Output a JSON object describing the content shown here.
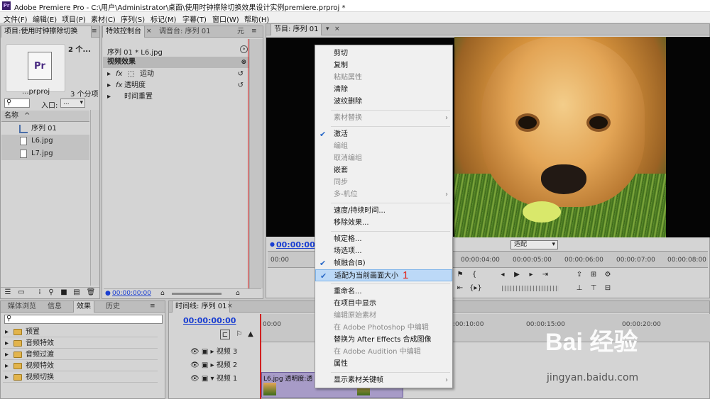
{
  "window": {
    "logo": "Pr",
    "title": "Adobe Premiere Pro - C:\\用户\\Administrator\\桌面\\使用时钟擦除切换效果设计实例premiere.prproj *"
  },
  "menu": [
    "文件(F)",
    "编辑(E)",
    "项目(P)",
    "素材(C)",
    "序列(S)",
    "标记(M)",
    "字幕(T)",
    "窗口(W)",
    "帮助(H)"
  ],
  "project": {
    "tab": "项目:使用时钟擦除切换",
    "item_count": "2 个...",
    "icon_text": "Pr",
    "filename": "...prproj",
    "subcount": "3 个分项",
    "entry_label": "入口:",
    "entry_value": "...",
    "column_name": "名称",
    "items": [
      "序列 01",
      "L6.jpg",
      "L7.jpg"
    ]
  },
  "effect_controls": {
    "tabs": [
      "特效控制台",
      "调音台: 序列 01",
      "元"
    ],
    "clip_label": "序列 01 * L6.jpg",
    "section": "视频效果",
    "rows": [
      "运动",
      "透明度",
      "时间重置"
    ],
    "timecode": "00:00:00:00"
  },
  "program": {
    "tab": "节目: 序列 01",
    "timecode": "00:00:00:0",
    "fit": "适配",
    "ruler": [
      "00:00",
      "00:00:04:00",
      "00:00:05:00",
      "00:00:06:00",
      "00:00:07:00",
      "00:00:08:00"
    ]
  },
  "effects": {
    "tabs": [
      "媒体浏览",
      "信息",
      "效果",
      "历史"
    ],
    "folders": [
      "预置",
      "音频特效",
      "音频过渡",
      "视频特效",
      "视频切换"
    ]
  },
  "timeline": {
    "tab": "时间线: 序列 01",
    "timecode": "00:00:00:00",
    "ruler": [
      "00:00",
      ":00:10:00",
      "00:00:15:00",
      "00:00:20:00"
    ],
    "tracks": [
      "视频 3",
      "视频 2",
      "视频 1"
    ],
    "clip": "L6.jpg  透明度:透"
  },
  "context_menu": {
    "items": [
      {
        "label": "剪切",
        "disabled": false,
        "checked": false,
        "submenu": false
      },
      {
        "label": "复制",
        "disabled": false,
        "checked": false,
        "submenu": false
      },
      {
        "label": "粘贴属性",
        "disabled": true,
        "checked": false,
        "submenu": false
      },
      {
        "label": "清除",
        "disabled": false,
        "checked": false,
        "submenu": false
      },
      {
        "label": "波纹删除",
        "disabled": false,
        "checked": false,
        "submenu": false
      },
      {
        "label": "素材替换",
        "disabled": true,
        "checked": false,
        "submenu": true
      },
      {
        "label": "激活",
        "disabled": false,
        "checked": true,
        "submenu": false
      },
      {
        "label": "编组",
        "disabled": true,
        "checked": false,
        "submenu": false
      },
      {
        "label": "取消编组",
        "disabled": true,
        "checked": false,
        "submenu": false
      },
      {
        "label": "嵌套",
        "disabled": false,
        "checked": false,
        "submenu": false
      },
      {
        "label": "同步",
        "disabled": true,
        "checked": false,
        "submenu": false
      },
      {
        "label": "多-机位",
        "disabled": true,
        "checked": false,
        "submenu": true
      },
      {
        "label": "速度/持续时间...",
        "disabled": false,
        "checked": false,
        "submenu": false
      },
      {
        "label": "移除效果...",
        "disabled": false,
        "checked": false,
        "submenu": false
      },
      {
        "label": "帧定格...",
        "disabled": false,
        "checked": false,
        "submenu": false
      },
      {
        "label": "场选项...",
        "disabled": false,
        "checked": false,
        "submenu": false
      },
      {
        "label": "帧融合(B)",
        "disabled": false,
        "checked": true,
        "submenu": false
      },
      {
        "label": "适配为当前画面大小",
        "disabled": false,
        "checked": true,
        "submenu": false,
        "highlighted": true
      },
      {
        "label": "重命名...",
        "disabled": false,
        "checked": false,
        "submenu": false
      },
      {
        "label": "在项目中显示",
        "disabled": false,
        "checked": false,
        "submenu": false
      },
      {
        "label": "编辑原始素材",
        "disabled": true,
        "checked": false,
        "submenu": false
      },
      {
        "label": "在 Adobe Photoshop 中编辑",
        "disabled": true,
        "checked": false,
        "submenu": false
      },
      {
        "label": "替换为 After Effects 合成图像",
        "disabled": false,
        "checked": false,
        "submenu": false
      },
      {
        "label": "在 Adobe Audition 中编辑",
        "disabled": true,
        "checked": false,
        "submenu": false
      },
      {
        "label": "属性",
        "disabled": false,
        "checked": false,
        "submenu": false
      },
      {
        "label": "显示素材关键帧",
        "disabled": false,
        "checked": false,
        "submenu": true
      }
    ]
  },
  "annotation": "1",
  "watermark": {
    "brand": "Bai 经验",
    "url": "jingyan.baidu.com"
  },
  "colors": {
    "timecode": "#1b3fd1",
    "highlight": "#bcd9f7",
    "annotation": "#e2261b"
  }
}
